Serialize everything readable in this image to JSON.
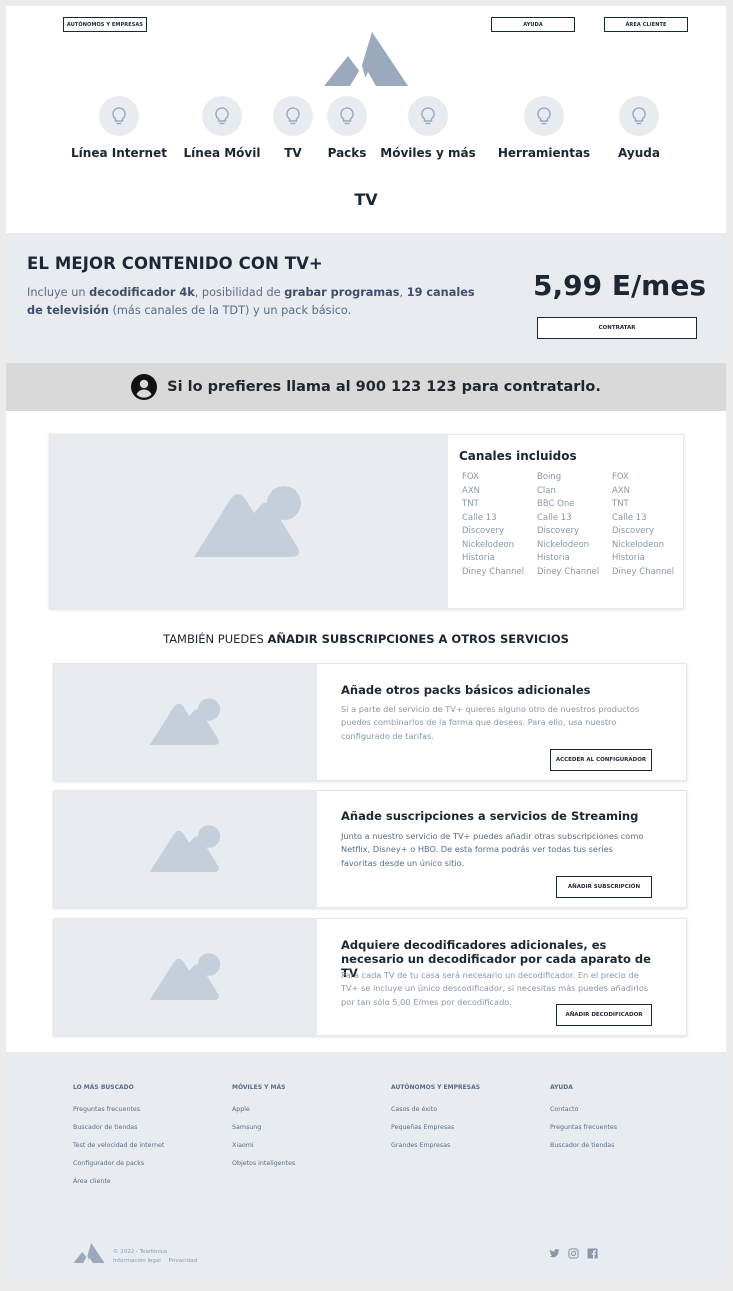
{
  "header": {
    "business_label": "AUTÓNOMOS Y EMPRESAS",
    "help_label": "AYUDA",
    "client_area_label": "ÁREA CLIENTE"
  },
  "nav": {
    "items": [
      {
        "label": "Línea Internet"
      },
      {
        "label": "Línea Móvil"
      },
      {
        "label": "TV"
      },
      {
        "label": "Packs"
      },
      {
        "label": "Móviles y más"
      },
      {
        "label": "Herramientas"
      },
      {
        "label": "Ayuda"
      }
    ]
  },
  "page_title": "TV",
  "hero": {
    "title": "EL MEJOR CONTENIDO CON TV+",
    "text_1": "Incluye un ",
    "bold_1": "decodificador 4k",
    "text_2": ", posibilidad de ",
    "bold_2": "grabar programas",
    "text_3": ", ",
    "bold_3": "19 canales de televisión",
    "text_4": " (más canales de la TDT) y un pack básico.",
    "price": "5,99 E/mes",
    "cta_label": "CONTRATAR"
  },
  "call_banner": {
    "text": "Si lo prefieres llama al 900 123 123 para contratarlo."
  },
  "channels": {
    "title": "Canales incluidos",
    "columns": [
      [
        "FOX",
        "AXN",
        "TNT",
        "Calle 13",
        "Discovery",
        "Nickelodeon",
        "Historia",
        "Diney Channel"
      ],
      [
        "Boing",
        "Clan",
        "BBC One",
        "Calle 13",
        "Discovery",
        "Nickelodeon",
        "Historia",
        "Diney Channel"
      ],
      [
        "FOX",
        "AXN",
        "TNT",
        "Calle 13",
        "Discovery",
        "Nickelodeon",
        "Historia",
        "Diney Channel"
      ]
    ]
  },
  "also": {
    "prefix": "TAMBIÉN PUEDES ",
    "bold": "AÑADIR SUBSCRIPCIONES A OTROS SERVICIOS"
  },
  "services": [
    {
      "title": "Añade otros packs básicos adicionales",
      "text": "Si a parte del servicio de TV+ quieres alguno otro de nuestros productos puedes combinarlos de la forma que desees. Para ello, usa nuestro configurado de tarifas.",
      "button": "ACCEDER AL CONFIGURADOR"
    },
    {
      "title": "Añade suscripciones a servicios de Streaming",
      "text": "Junto a nuestro servicio de TV+ puedes añadir otras subscripciones como Netflix, Disney+ o HBO. De esta forma podrás ver todas tus series favoritas desde un único sitio.",
      "button": "AÑADIR SUBSCRIPCIÓN"
    },
    {
      "title": "Adquiere decodificadores adicionales, es necesario un decodificador por cada aparato de TV",
      "text": "Para cada TV de tu casa será necesario un decodificador. En el precio de TV+ se incluye un único descodificador, si necesitas más puedes añadirlos por tan sólo 5,00 E/mes por decodificado.",
      "button": "AÑADIR DECODIFICADOR"
    }
  ],
  "footer": {
    "columns": [
      {
        "heading": "LO MÁS BUSCADO",
        "links": [
          "Preguntas frecuentes",
          "Buscador de tiendas",
          "Test de velocidad de internet",
          "Configurador de packs",
          "Área cliente"
        ]
      },
      {
        "heading": "MÓVILES Y MÁS",
        "links": [
          "Apple",
          "Samsung",
          "Xiaomi",
          "Objetos inteligentes"
        ]
      },
      {
        "heading": "AUTÓNOMOS Y EMPRESAS",
        "links": [
          "Casos de éxito",
          "Pequeñas Empresas",
          "Grandes Empresas"
        ]
      },
      {
        "heading": "AYUDA",
        "links": [
          "Contacto",
          "Preguntas frecuentes",
          "Buscador de tiendas"
        ]
      }
    ],
    "copyright": "© 2022 - Telefónico",
    "legal": "Información legal",
    "privacy": "Privacidad",
    "social": [
      "twitter-icon",
      "instagram-icon",
      "facebook-icon"
    ]
  },
  "colors": {
    "dark": "#1d2633",
    "muted": "#5b6b84",
    "light_bg": "#e8ecf1",
    "placeholder_shape": "#c5cfdb",
    "logo": "#9aa9bc"
  }
}
